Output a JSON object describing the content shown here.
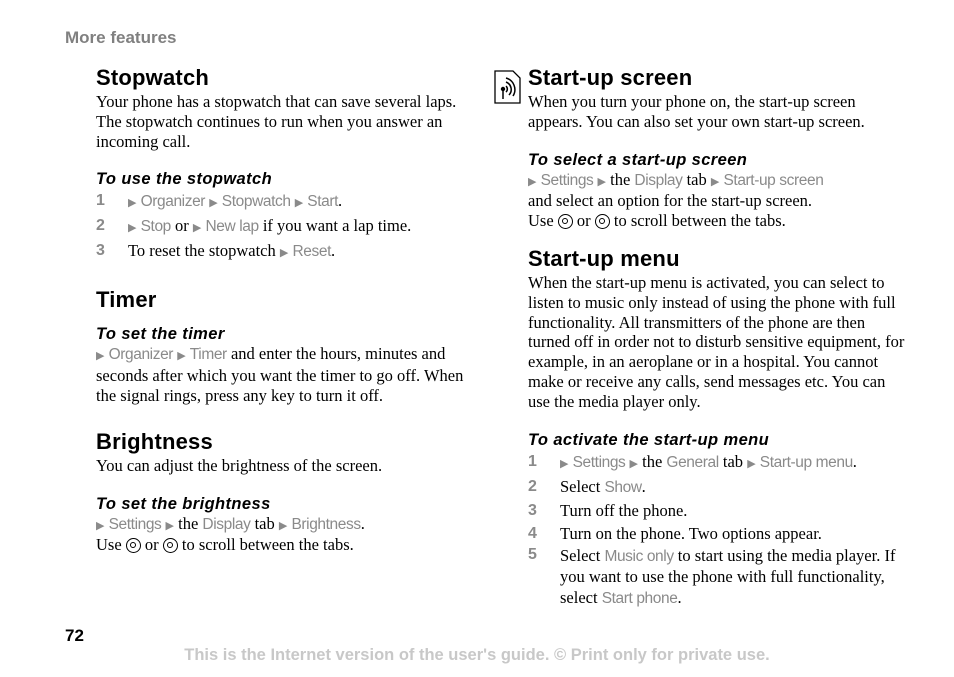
{
  "header": {
    "section": "More features"
  },
  "left": {
    "stopwatch": {
      "title": "Stopwatch",
      "intro": "Your phone has a stopwatch that can save several laps. The stopwatch continues to run when you answer an incoming call.",
      "howto_title": "To use the stopwatch",
      "steps": [
        {
          "num": "1",
          "menu": [
            "Organizer",
            "Stopwatch",
            "Start"
          ],
          "suffix": "."
        },
        {
          "num": "2",
          "menu_a": "Stop",
          "or": "or",
          "menu_b": "New lap",
          "suffix": "if you want a lap time."
        },
        {
          "num": "3",
          "prefix": "To reset the stopwatch",
          "menu": "Reset",
          "suffix": "."
        }
      ]
    },
    "timer": {
      "title": "Timer",
      "howto_title": "To set the timer",
      "menu": [
        "Organizer",
        "Timer"
      ],
      "text": "and enter the hours, minutes and seconds after which you want the timer to go off. When the signal rings, press any key to turn it off."
    },
    "brightness": {
      "title": "Brightness",
      "intro": "You can adjust the brightness of the screen.",
      "howto_title": "To set the brightness",
      "menu_settings": "Settings",
      "the": "the",
      "menu_display": "Display",
      "tab": "tab",
      "menu_brightness": "Brightness",
      "use": "Use",
      "or": "or",
      "scroll_text": "to scroll between the tabs."
    }
  },
  "right": {
    "startup_screen": {
      "icon": "network-service-icon",
      "title": "Start-up screen",
      "intro": "When you turn your phone on, the start-up screen appears. You can also set your own start-up screen.",
      "howto_title": "To select a start-up screen",
      "menu_settings": "Settings",
      "the": "the",
      "menu_display": "Display",
      "tab": "tab",
      "menu_startup": "Start-up screen",
      "after": "and select an option for the start-up screen.",
      "use": "Use",
      "or": "or",
      "scroll_text": "to scroll between the tabs."
    },
    "startup_menu": {
      "title": "Start-up menu",
      "intro": "When the start-up menu is activated, you can select to listen to music only instead of using the phone with full functionality. All transmitters of the phone are then turned off in order not to disturb sensitive equipment, for example, in an aeroplane or in a hospital. You cannot make or receive any calls, send messages etc. You can use the media player only.",
      "howto_title": "To activate the start-up menu",
      "steps": [
        {
          "num": "1",
          "menu_settings": "Settings",
          "the": "the",
          "menu_general": "General",
          "tab": "tab",
          "menu_startup": "Start-up menu",
          "suffix": "."
        },
        {
          "num": "2",
          "prefix": "Select",
          "menu": "Show",
          "suffix": "."
        },
        {
          "num": "3",
          "text": "Turn off the phone."
        },
        {
          "num": "4",
          "text": "Turn on the phone. Two options appear."
        },
        {
          "num": "5",
          "prefix": "Select",
          "menu_a": "Music only",
          "middle": "to start using the media player. If you want to use the phone with full functionality, select",
          "menu_b": "Start phone",
          "suffix": "."
        }
      ]
    }
  },
  "footer": {
    "page_number": "72",
    "notice": "This is the Internet version of the user's guide. © Print only for private use."
  },
  "colors": {
    "menu_grey": "#8a8a8a",
    "footer_grey": "#c8c8c8",
    "section_grey": "#808080"
  }
}
